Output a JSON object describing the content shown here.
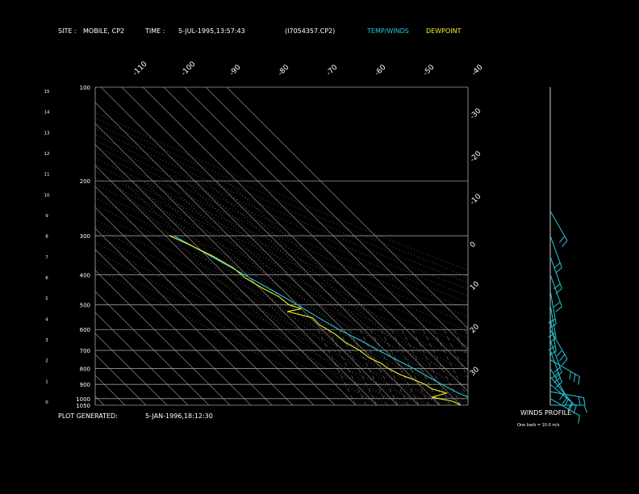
{
  "header": {
    "site_label": "SITE :",
    "site_value": "MOBILE, CP2",
    "time_label": "TIME :",
    "time_value": "5-JUL-1995,13:57:43",
    "file_id": "(I7054357.CP2)",
    "legend_temp": "TEMP/WINDS",
    "legend_dew": "DEWPOINT",
    "temp_color": "#27c8d8",
    "dew_color": "#f2f22a"
  },
  "footer": {
    "plot_label": "PLOT GENERATED:",
    "plot_value": "5-JAN-1996,18:12:30",
    "winds_title": "WINDS PROFILE",
    "winds_note": "One barb = 10.0 m/s"
  },
  "chart_data": {
    "type": "line",
    "title": "",
    "pressure_levels": [
      100,
      200,
      300,
      400,
      500,
      600,
      700,
      800,
      900,
      1000,
      1050
    ],
    "pressure_ticks": [
      "100",
      "200",
      "300",
      "400",
      "500",
      "600",
      "700",
      "800",
      "900",
      "1000",
      "1050"
    ],
    "height_ticks": [
      "15",
      "14",
      "13",
      "12",
      "11",
      "10",
      "9",
      "8",
      "7",
      "6",
      "5",
      "4",
      "3",
      "2",
      "1",
      "0"
    ],
    "top_temp_ticks": [
      "-110",
      "-100",
      "-90",
      "-80",
      "-70",
      "-60",
      "-50",
      "-40"
    ],
    "right_temp_ticks": [
      "-30",
      "-20",
      "-10",
      "0",
      "10",
      "20",
      "30"
    ],
    "ylim": [
      1050,
      100
    ],
    "grid": true,
    "series": [
      {
        "name": "TEMP/WINDS",
        "color": "#27c8d8",
        "points": [
          {
            "p": 1050,
            "t": 35
          },
          {
            "p": 1000,
            "t": 28
          },
          {
            "p": 950,
            "t": 24
          },
          {
            "p": 900,
            "t": 21
          },
          {
            "p": 850,
            "t": 18
          },
          {
            "p": 800,
            "t": 15
          },
          {
            "p": 750,
            "t": 11
          },
          {
            "p": 700,
            "t": 7
          },
          {
            "p": 650,
            "t": 3
          },
          {
            "p": 600,
            "t": -2
          },
          {
            "p": 550,
            "t": -6
          },
          {
            "p": 500,
            "t": -10
          },
          {
            "p": 450,
            "t": -15
          },
          {
            "p": 400,
            "t": -21
          },
          {
            "p": 350,
            "t": -28
          },
          {
            "p": 300,
            "t": -36
          }
        ]
      },
      {
        "name": "DEWPOINT",
        "color": "#f2f22a",
        "points": [
          {
            "p": 1050,
            "t": 20
          },
          {
            "p": 1020,
            "t": 18
          },
          {
            "p": 990,
            "t": 10
          },
          {
            "p": 960,
            "t": 19
          },
          {
            "p": 930,
            "t": 14
          },
          {
            "p": 900,
            "t": 13
          },
          {
            "p": 870,
            "t": 10
          },
          {
            "p": 840,
            "t": 6
          },
          {
            "p": 800,
            "t": 3
          },
          {
            "p": 770,
            "t": 2
          },
          {
            "p": 740,
            "t": -1
          },
          {
            "p": 700,
            "t": -2
          },
          {
            "p": 660,
            "t": -5
          },
          {
            "p": 620,
            "t": -6
          },
          {
            "p": 580,
            "t": -9
          },
          {
            "p": 550,
            "t": -9
          },
          {
            "p": 525,
            "t": -18
          },
          {
            "p": 515,
            "t": -10
          },
          {
            "p": 500,
            "t": -14
          },
          {
            "p": 470,
            "t": -15
          },
          {
            "p": 440,
            "t": -19
          },
          {
            "p": 410,
            "t": -22
          },
          {
            "p": 380,
            "t": -23
          },
          {
            "p": 350,
            "t": -27
          },
          {
            "p": 320,
            "t": -33
          },
          {
            "p": 300,
            "t": -38
          }
        ]
      }
    ],
    "winds": [
      {
        "p": 1050,
        "speed": 10,
        "dir": 90
      },
      {
        "p": 1000,
        "speed": 10,
        "dir": 120
      },
      {
        "p": 950,
        "speed": 20,
        "dir": 100
      },
      {
        "p": 900,
        "speed": 20,
        "dir": 130
      },
      {
        "p": 850,
        "speed": 20,
        "dir": 140
      },
      {
        "p": 800,
        "speed": 20,
        "dir": 150
      },
      {
        "p": 750,
        "speed": 30,
        "dir": 120
      },
      {
        "p": 700,
        "speed": 30,
        "dir": 160
      },
      {
        "p": 650,
        "speed": 20,
        "dir": 160
      },
      {
        "p": 600,
        "speed": 30,
        "dir": 150
      },
      {
        "p": 550,
        "speed": 20,
        "dir": 170
      },
      {
        "p": 500,
        "speed": 20,
        "dir": 170
      },
      {
        "p": 450,
        "speed": 20,
        "dir": 170
      },
      {
        "p": 400,
        "speed": 20,
        "dir": 160
      },
      {
        "p": 350,
        "speed": 20,
        "dir": 160
      },
      {
        "p": 300,
        "speed": 20,
        "dir": 160
      },
      {
        "p": 250,
        "speed": 20,
        "dir": 150
      }
    ]
  }
}
